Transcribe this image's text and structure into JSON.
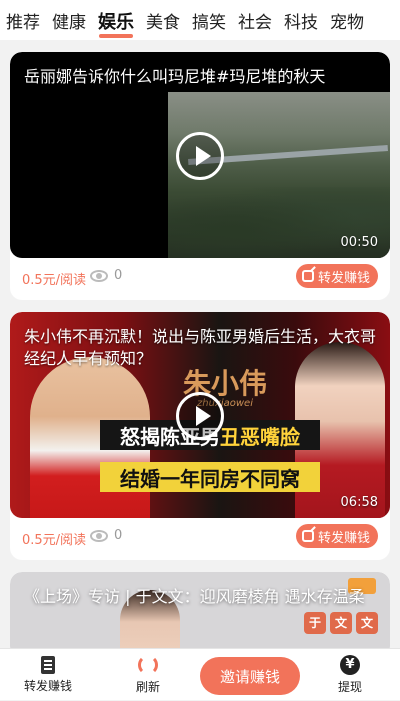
{
  "tabs": [
    "推荐",
    "健康",
    "娱乐",
    "美食",
    "搞笑",
    "社会",
    "科技",
    "宠物"
  ],
  "active_tab_index": 2,
  "feed": {
    "cards": [
      {
        "title": "岳丽娜告诉你什么叫玛尼堆#玛尼堆的秋天",
        "duration": "00:50",
        "price": "0.5元/阅读",
        "views": "0",
        "share_label": "转发赚钱"
      },
      {
        "title": "朱小伟不再沉默！说出与陈亚男婚后生活，大衣哥经纪人早有预知？",
        "brand": "朱小伟",
        "brand_sub": "zhuxiaowei",
        "band1_prefix": "怒揭陈亚男",
        "band1_highlight": "丑恶嘴脸",
        "band2": "结婚一年同房不同窝",
        "duration": "06:58",
        "price": "0.5元/阅读",
        "views": "0",
        "share_label": "转发赚钱"
      },
      {
        "title": "《上场》专访 | 于文文：迎风磨棱角 遇水存温柔",
        "seal_chars": [
          "于",
          "文",
          "文"
        ]
      }
    ]
  },
  "bottom_nav": {
    "share": "转发赚钱",
    "refresh": "刷新",
    "invite": "邀请赚钱",
    "withdraw": "提现"
  },
  "colors": {
    "accent": "#f2735a"
  }
}
